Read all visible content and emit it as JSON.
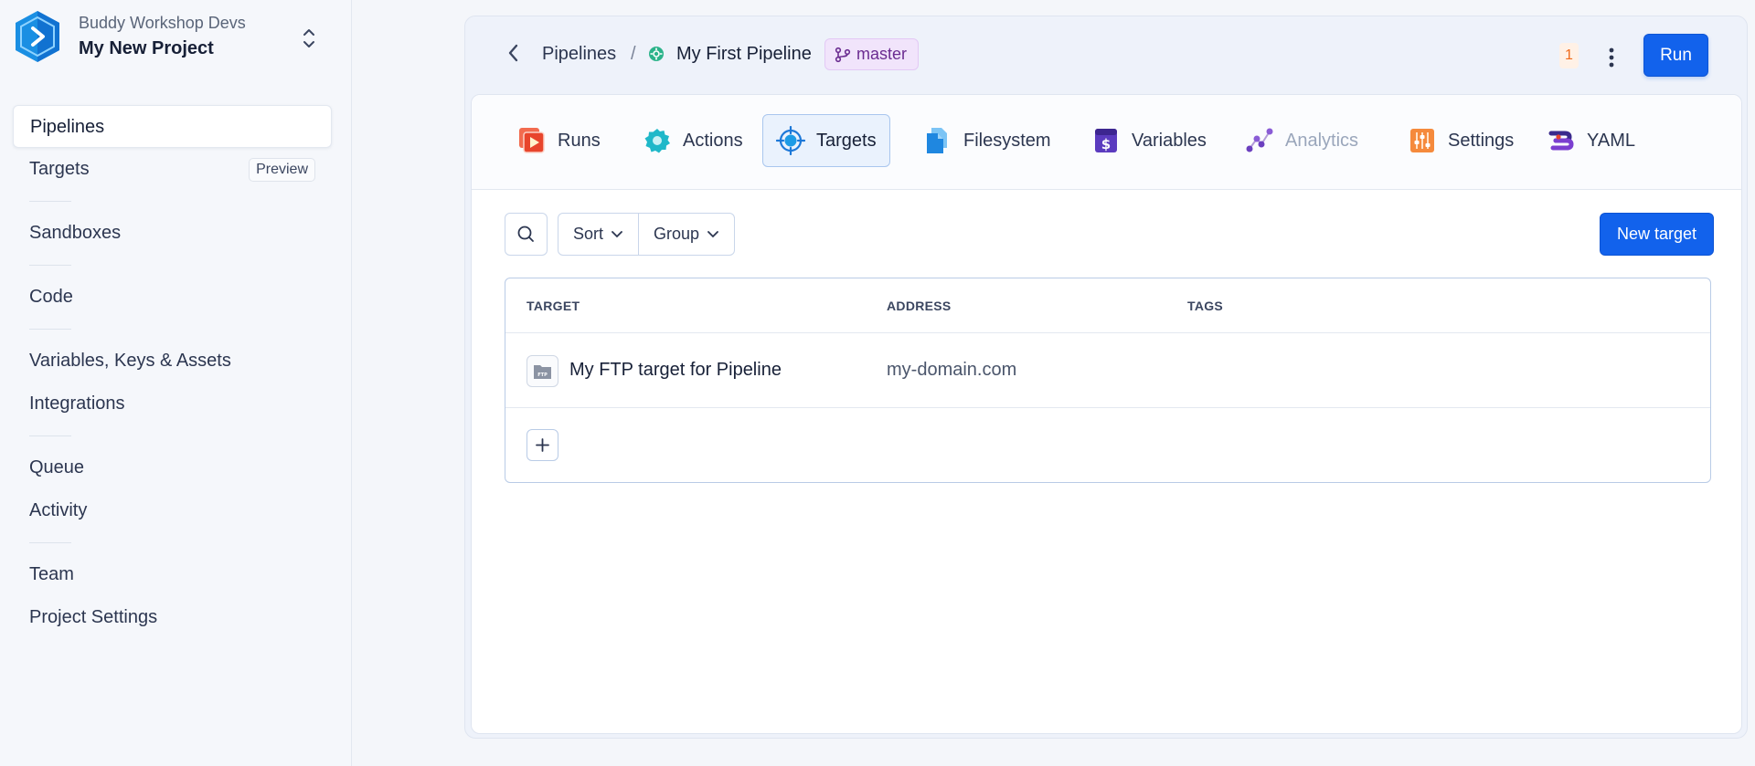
{
  "sidebar": {
    "workspace_name": "Buddy Workshop Devs",
    "project_name": "My New Project",
    "items": [
      {
        "label": "Pipelines"
      },
      {
        "label": "Targets",
        "badge": "Preview"
      },
      {
        "label": "Sandboxes"
      },
      {
        "label": "Code"
      },
      {
        "label": "Variables, Keys & Assets"
      },
      {
        "label": "Integrations"
      },
      {
        "label": "Queue"
      },
      {
        "label": "Activity"
      },
      {
        "label": "Team"
      },
      {
        "label": "Project Settings"
      }
    ]
  },
  "breadcrumb": {
    "pipelines": "Pipelines",
    "separator": "/",
    "pipeline": "My First Pipeline",
    "branch": "master"
  },
  "header": {
    "notification_count": "1",
    "run_label": "Run"
  },
  "tabs": [
    {
      "label": "Runs"
    },
    {
      "label": "Actions"
    },
    {
      "label": "Targets"
    },
    {
      "label": "Filesystem"
    },
    {
      "label": "Variables"
    },
    {
      "label": "Analytics"
    },
    {
      "label": "Settings"
    },
    {
      "label": "YAML"
    }
  ],
  "toolbar": {
    "sort_label": "Sort",
    "group_label": "Group",
    "new_target_label": "New target"
  },
  "table": {
    "columns": [
      "TARGET",
      "ADDRESS",
      "TAGS"
    ],
    "rows": [
      {
        "target": "My FTP target for Pipeline",
        "address": "my-domain.com",
        "tags": ""
      }
    ]
  },
  "colors": {
    "primary": "#1262ec",
    "branch_badge_bg": "#f1e4fb",
    "branch_text": "#6b2c91",
    "notification": "#f06a1a"
  }
}
